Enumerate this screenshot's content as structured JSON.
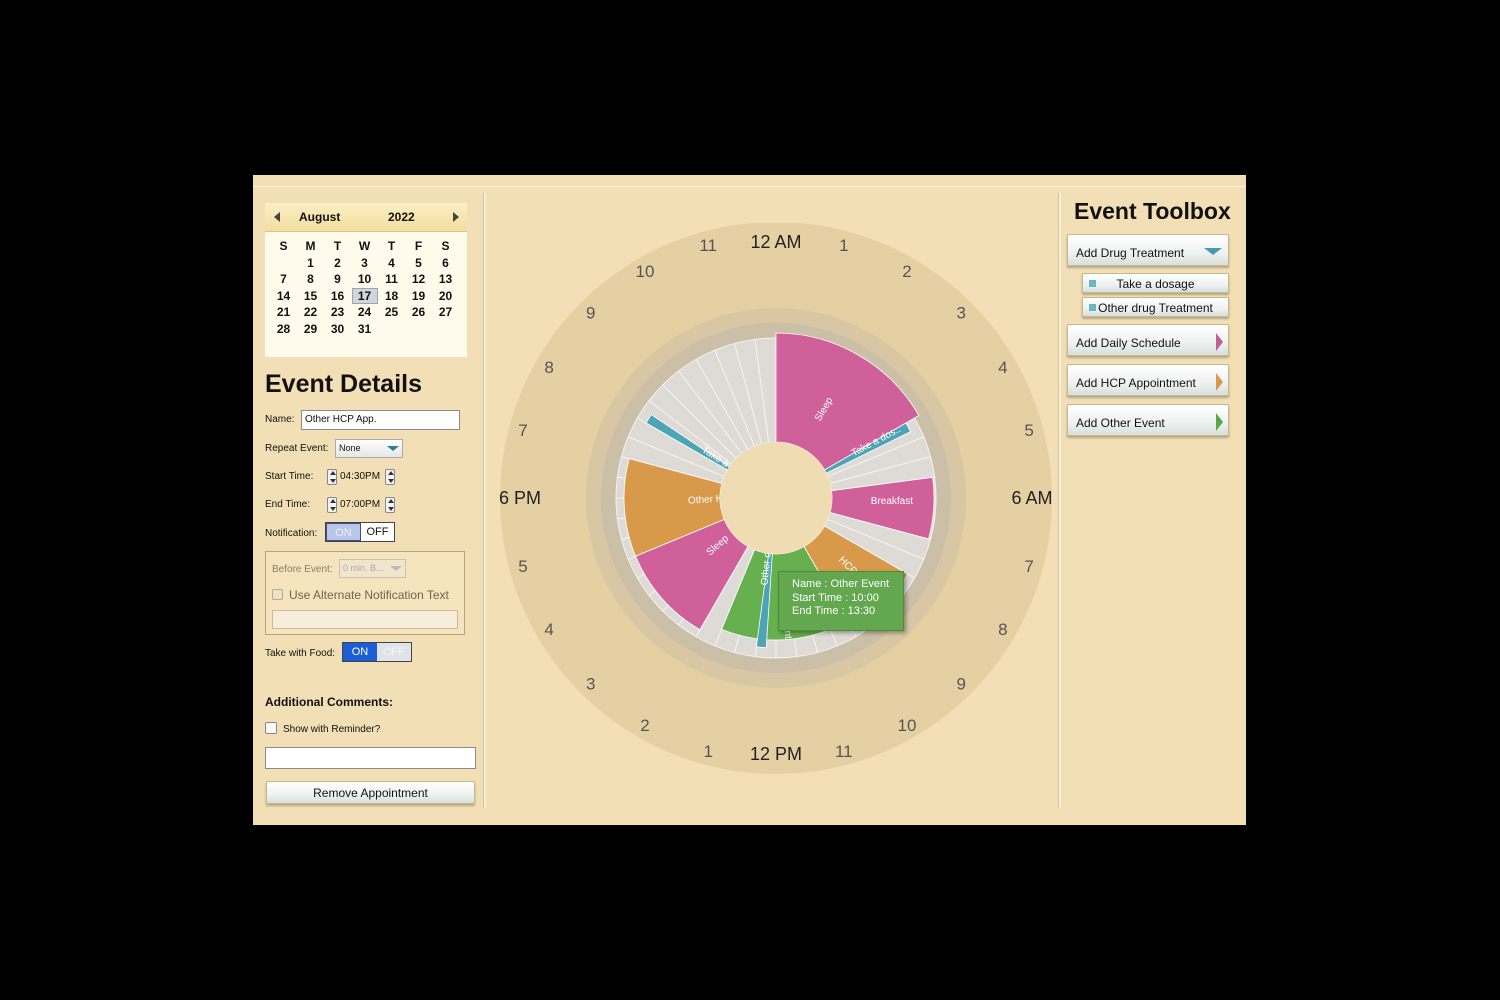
{
  "calendar": {
    "month": "August",
    "year": "2022",
    "weekdays": [
      "S",
      "M",
      "T",
      "W",
      "T",
      "F",
      "S"
    ],
    "weeks": [
      [
        "",
        "1",
        "2",
        "3",
        "4",
        "5",
        "6"
      ],
      [
        "7",
        "8",
        "9",
        "10",
        "11",
        "12",
        "13"
      ],
      [
        "14",
        "15",
        "16",
        "17",
        "18",
        "19",
        "20"
      ],
      [
        "21",
        "22",
        "23",
        "24",
        "25",
        "26",
        "27"
      ],
      [
        "28",
        "29",
        "30",
        "31",
        "",
        "",
        ""
      ]
    ],
    "selected_day": "17"
  },
  "details": {
    "title": "Event Details",
    "name_label": "Name:",
    "name_value": "Other HCP App.",
    "repeat_label": "Repeat Event:",
    "repeat_value": "None",
    "start_label": "Start Time:",
    "start_value": "04:30PM",
    "end_label": "End Time:",
    "end_value": "07:00PM",
    "notification_label": "Notification:",
    "notification_on": "ON",
    "notification_off": "OFF",
    "before_label": "Before Event:",
    "before_value": "0 min. B...",
    "alt_text_label": "Use Alternate Notification Text",
    "alt_text_value": "",
    "food_label": "Take with Food:",
    "food_on": "ON",
    "food_off": "OFF",
    "comments_label": "Additional Comments:",
    "reminder_label": "Show with Reminder?",
    "comments_value": "",
    "remove_button": "Remove Appointment"
  },
  "toolbox": {
    "title": "Event Toolbox",
    "add_drug": "Add Drug Treatment",
    "take_dosage": "Take a dosage",
    "other_drug": "Other drug Treatment",
    "add_daily": "Add Daily Schedule",
    "add_hcp": "Add HCP Appointment",
    "add_other": "Add Other Event",
    "colors": {
      "drug": "#4b9ab3",
      "daily": "#c0609a",
      "hcp": "#d89a4a",
      "other": "#5aa64a"
    }
  },
  "clock": {
    "label_12am": "12 AM",
    "label_6am": "6 AM",
    "label_12pm": "12 PM",
    "label_6pm": "6 PM",
    "hour_labels": [
      "1",
      "2",
      "3",
      "4",
      "5",
      "7",
      "8",
      "9",
      "10",
      "11",
      "11",
      "10",
      "9",
      "8",
      "7",
      "5",
      "4",
      "3",
      "2",
      "1"
    ],
    "events": [
      {
        "label": "Sleep",
        "start": 0,
        "end": 4,
        "color": "#d0609a",
        "icon": "sleep-icon"
      },
      {
        "label": "Take a dos..",
        "start": 4,
        "end": 4.25,
        "color": "#4fa3b6",
        "icon": ""
      },
      {
        "label": "Breakfast",
        "start": 5.5,
        "end": 7,
        "color": "#d0609a",
        "icon": "breakfast-icon"
      },
      {
        "label": "HCP",
        "start": 8,
        "end": 10,
        "color": "#d89a4a",
        "icon": ""
      },
      {
        "label": "Other Event",
        "start": 10,
        "end": 13.5,
        "color": "#67b04f",
        "icon": ""
      },
      {
        "label": "Other drug..",
        "start": 12.25,
        "end": 12.5,
        "color": "#4fa3b6",
        "icon": ""
      },
      {
        "label": "Sleep",
        "start": 14,
        "end": 16.5,
        "color": "#d0609a",
        "icon": "sleep-icon"
      },
      {
        "label": "Other HCP ..",
        "start": 16.5,
        "end": 19,
        "color": "#d89a4a",
        "icon": ""
      },
      {
        "label": "Take a dos..",
        "start": 20,
        "end": 20.25,
        "color": "#4fa3b6",
        "icon": ""
      }
    ]
  },
  "tooltip": {
    "name": "Name : Other Event",
    "start": "Start Time : 10:00",
    "end": "End Time : 13:30"
  }
}
